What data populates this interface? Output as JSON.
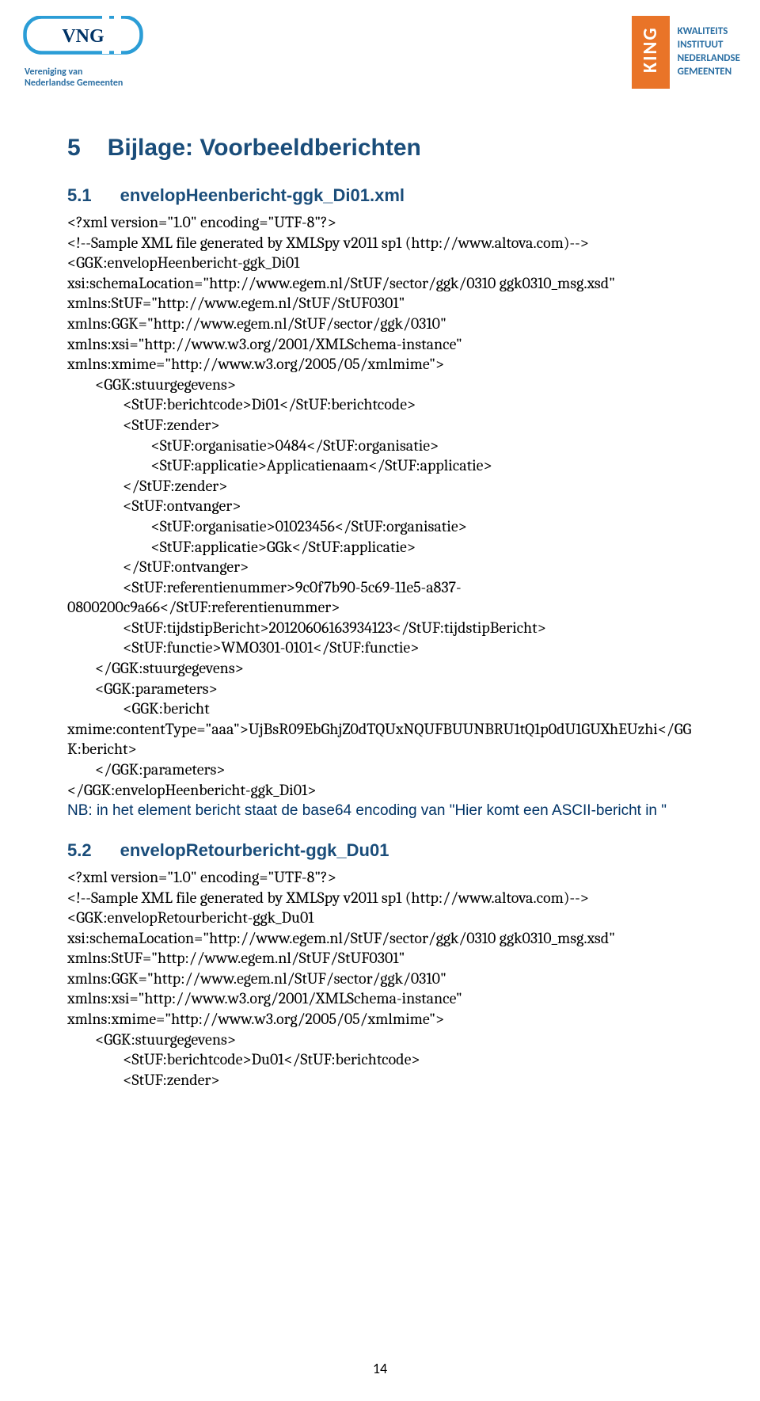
{
  "header": {
    "vng_tagline_line1": "Vereniging van",
    "vng_tagline_line2": "Nederlandse Gemeenten",
    "king_label": "KING",
    "king_text_line1": "KWALITEITS",
    "king_text_line2": "INSTITUUT",
    "king_text_line3": "NEDERLANDSE",
    "king_text_line4": "GEMEENTEN"
  },
  "chapter": {
    "num": "5",
    "title": "Bijlage: Voorbeeldberichten"
  },
  "section1": {
    "num": "5.1",
    "title": "envelopHeenbericht-ggk_Di01.xml",
    "body": "<?xml version=\"1.0\" encoding=\"UTF-8\"?>\n<!--Sample XML file generated by XMLSpy v2011 sp1 (http://www.altova.com)-->\n<GGK:envelopHeenbericht-ggk_Di01\nxsi:schemaLocation=\"http://www.egem.nl/StUF/sector/ggk/0310 ggk0310_msg.xsd\"\nxmlns:StUF=\"http://www.egem.nl/StUF/StUF0301\"\nxmlns:GGK=\"http://www.egem.nl/StUF/sector/ggk/0310\"\nxmlns:xsi=\"http://www.w3.org/2001/XMLSchema-instance\"\nxmlns:xmime=\"http://www.w3.org/2005/05/xmlmime\">\n\t<GGK:stuurgegevens>\n\t\t<StUF:berichtcode>Di01</StUF:berichtcode>\n\t\t<StUF:zender>\n\t\t\t<StUF:organisatie>0484</StUF:organisatie>\n\t\t\t<StUF:applicatie>Applicatienaam</StUF:applicatie>\n\t\t</StUF:zender>\n\t\t<StUF:ontvanger>\n\t\t\t<StUF:organisatie>01023456</StUF:organisatie>\n\t\t\t<StUF:applicatie>GGk</StUF:applicatie>\n\t\t</StUF:ontvanger>\n\t\t<StUF:referentienummer>9c0f7b90-5c69-11e5-a837-0800200c9a66</StUF:referentienummer>\n\t\t<StUF:tijdstipBericht>20120606163934123</StUF:tijdstipBericht>\n\t\t<StUF:functie>WMO301-0101</StUF:functie>\n\t</GGK:stuurgegevens>\n\t<GGK:parameters>\n\t\t<GGK:bericht\nxmime:contentType=\"aaa\">UjBsR09EbGhjZ0dTQUxNQUFBUUNBRU1tQ1p0dU1GUXhEUzhi</GGK:bericht>\n\t</GGK:parameters>\n</GGK:envelopHeenbericht-ggk_Di01>",
    "note": "NB: in het element bericht staat de base64 encoding van \"Hier komt een ASCII-bericht in \""
  },
  "section2": {
    "num": "5.2",
    "title": "envelopRetourbericht-ggk_Du01",
    "body": "<?xml version=\"1.0\" encoding=\"UTF-8\"?>\n<!--Sample XML file generated by XMLSpy v2011 sp1 (http://www.altova.com)-->\n<GGK:envelopRetourbericht-ggk_Du01\nxsi:schemaLocation=\"http://www.egem.nl/StUF/sector/ggk/0310 ggk0310_msg.xsd\"\nxmlns:StUF=\"http://www.egem.nl/StUF/StUF0301\"\nxmlns:GGK=\"http://www.egem.nl/StUF/sector/ggk/0310\"\nxmlns:xsi=\"http://www.w3.org/2001/XMLSchema-instance\"\nxmlns:xmime=\"http://www.w3.org/2005/05/xmlmime\">\n\t<GGK:stuurgegevens>\n\t\t<StUF:berichtcode>Du01</StUF:berichtcode>\n\t\t<StUF:zender>"
  },
  "page_number": "14"
}
